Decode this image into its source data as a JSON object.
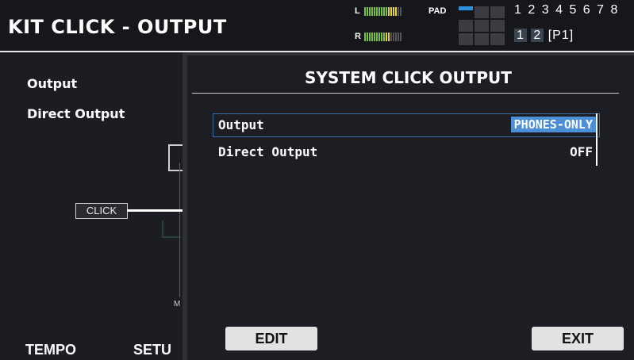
{
  "header": {
    "title": "KIT CLICK - OUTPUT",
    "meter_l_label": "L",
    "meter_r_label": "R",
    "pad_label": "PAD",
    "kit_numbers": [
      "1",
      "2",
      "3",
      "4",
      "5",
      "6",
      "7",
      "8"
    ],
    "bank_numbers": [
      "1",
      "2"
    ],
    "bank_page": "[P1]"
  },
  "background": {
    "output_label": "Output",
    "direct_output_label": "Direct Output",
    "click_label": "CLICK",
    "m_letter": "M",
    "tabs": [
      "TEMPO",
      "SETU"
    ]
  },
  "dialog": {
    "title": "SYSTEM CLICK OUTPUT",
    "rows": [
      {
        "label": "Output",
        "value": "PHONES-ONLY"
      },
      {
        "label": "Direct Output",
        "value": "OFF"
      }
    ],
    "buttons": {
      "edit": "EDIT",
      "exit": "EXIT"
    }
  },
  "colors": {
    "selection": "#4d8fd6",
    "background": "#1c1d22",
    "meter_green": "#7bc142",
    "meter_yellow": "#e8d23a",
    "pad_active": "#2c8fe0"
  }
}
